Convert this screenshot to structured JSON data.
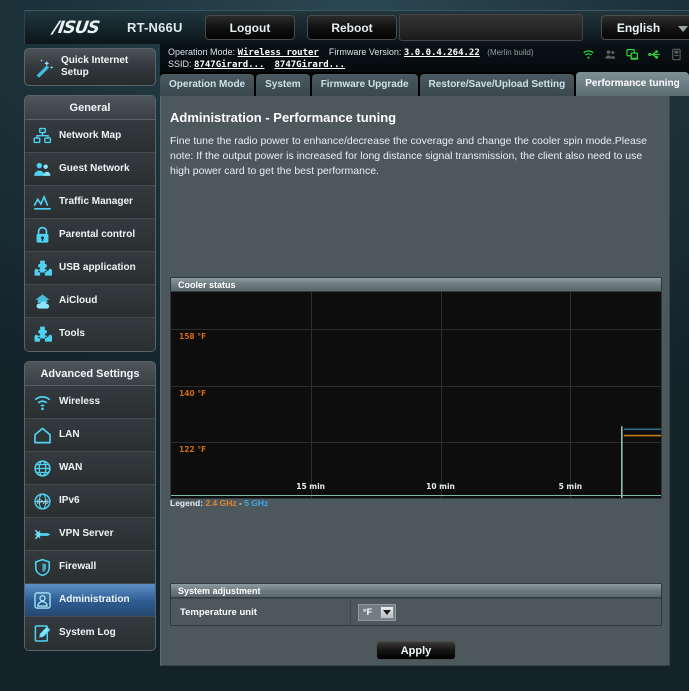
{
  "header": {
    "brand": "/ISUS",
    "model": "RT-N66U",
    "logout_label": "Logout",
    "reboot_label": "Reboot",
    "language": "English"
  },
  "info": {
    "operation_mode_label": "Operation Mode:",
    "operation_mode_value": "Wireless router",
    "firmware_label": "Firmware Version:",
    "firmware_value": "3.0.0.4.264.22",
    "firmware_note": "(Merlin build)",
    "ssid_label": "SSID:",
    "ssid_value_1": "8747Girard...",
    "ssid_value_2": "8747Girard...",
    "status_icons": [
      {
        "name": "wifi-icon",
        "state": "active"
      },
      {
        "name": "guest-users-icon",
        "state": "inactive"
      },
      {
        "name": "devices-icon",
        "state": "active"
      },
      {
        "name": "usb-icon",
        "state": "active"
      },
      {
        "name": "printer-icon",
        "state": "inactive"
      }
    ]
  },
  "tabs": [
    {
      "label": "Operation Mode",
      "active": false
    },
    {
      "label": "System",
      "active": false
    },
    {
      "label": "Firmware Upgrade",
      "active": false
    },
    {
      "label": "Restore/Save/Upload Setting",
      "active": false
    },
    {
      "label": "Performance tuning",
      "active": true
    }
  ],
  "sidebar": {
    "quick_setup": "Quick Internet Setup",
    "general_header": "General",
    "general_items": [
      {
        "label": "Network Map",
        "icon": "network-map-icon"
      },
      {
        "label": "Guest Network",
        "icon": "guest-network-icon"
      },
      {
        "label": "Traffic Manager",
        "icon": "traffic-manager-icon"
      },
      {
        "label": "Parental control",
        "icon": "parental-control-icon"
      },
      {
        "label": "USB application",
        "icon": "usb-application-icon"
      },
      {
        "label": "AiCloud",
        "icon": "aicloud-icon"
      },
      {
        "label": "Tools",
        "icon": "tools-icon"
      }
    ],
    "advanced_header": "Advanced Settings",
    "advanced_items": [
      {
        "label": "Wireless",
        "icon": "wireless-icon",
        "active": false
      },
      {
        "label": "LAN",
        "icon": "lan-icon",
        "active": false
      },
      {
        "label": "WAN",
        "icon": "wan-icon",
        "active": false
      },
      {
        "label": "IPv6",
        "icon": "ipv6-icon",
        "active": false
      },
      {
        "label": "VPN Server",
        "icon": "vpn-server-icon",
        "active": false
      },
      {
        "label": "Firewall",
        "icon": "firewall-icon",
        "active": false
      },
      {
        "label": "Administration",
        "icon": "administration-icon",
        "active": true
      },
      {
        "label": "System Log",
        "icon": "system-log-icon",
        "active": false
      }
    ]
  },
  "main": {
    "title": "Administration - Performance tuning",
    "description": "Fine tune the radio power to enhance/decrease the coverage and change the cooler spin mode.Please note: If the output power is increased for long distance signal transmission, the client also need to use high power card to get the best performance.",
    "cooler_panel_title": "Cooler status",
    "legend_prefix": "Legend:",
    "legend_24": "2.4 GHz",
    "legend_sep": "-",
    "legend_5": "5 GHz",
    "sysadj_panel_title": "System adjustment",
    "temperature_unit_label": "Temperature unit",
    "temperature_unit_value": "°F",
    "apply_label": "Apply"
  },
  "chart_data": {
    "type": "line",
    "title": "Cooler status",
    "xlabel": "",
    "ylabel": "",
    "x_tick_labels": [
      "15 min",
      "10 min",
      "5 min"
    ],
    "x_tick_positions_pct": [
      28.5,
      55.0,
      81.5
    ],
    "y_tick_labels": [
      "158 °F",
      "140 °F",
      "122 °F"
    ],
    "y_values": [
      158,
      140,
      122
    ],
    "ylim": [
      104,
      170
    ],
    "xlim_minutes": [
      20,
      0
    ],
    "grid": true,
    "grid_color": "#2e2e2e",
    "background": "#0d0d0d",
    "axis_color": "#7fb9ad",
    "legend_position": "below-chart",
    "series": [
      {
        "name": "2.4 GHz",
        "color": "#c07a1e",
        "points": [
          {
            "x_pct": 0,
            "value": null
          },
          {
            "x_pct": 92.0,
            "value": null
          },
          {
            "x_pct": 92.4,
            "value": 124
          },
          {
            "x_pct": 100,
            "value": 124
          }
        ]
      },
      {
        "name": "5 GHz",
        "color": "#2e6e86",
        "points": [
          {
            "x_pct": 0,
            "value": null
          },
          {
            "x_pct": 92.0,
            "value": null
          },
          {
            "x_pct": 92.4,
            "value": 126
          },
          {
            "x_pct": 100,
            "value": 126
          }
        ]
      },
      {
        "name": "trace-edge",
        "color": "#8fbfb0",
        "points": [
          {
            "x_pct": 92.0,
            "value": 104
          },
          {
            "x_pct": 92.0,
            "value": 127
          }
        ]
      }
    ]
  }
}
